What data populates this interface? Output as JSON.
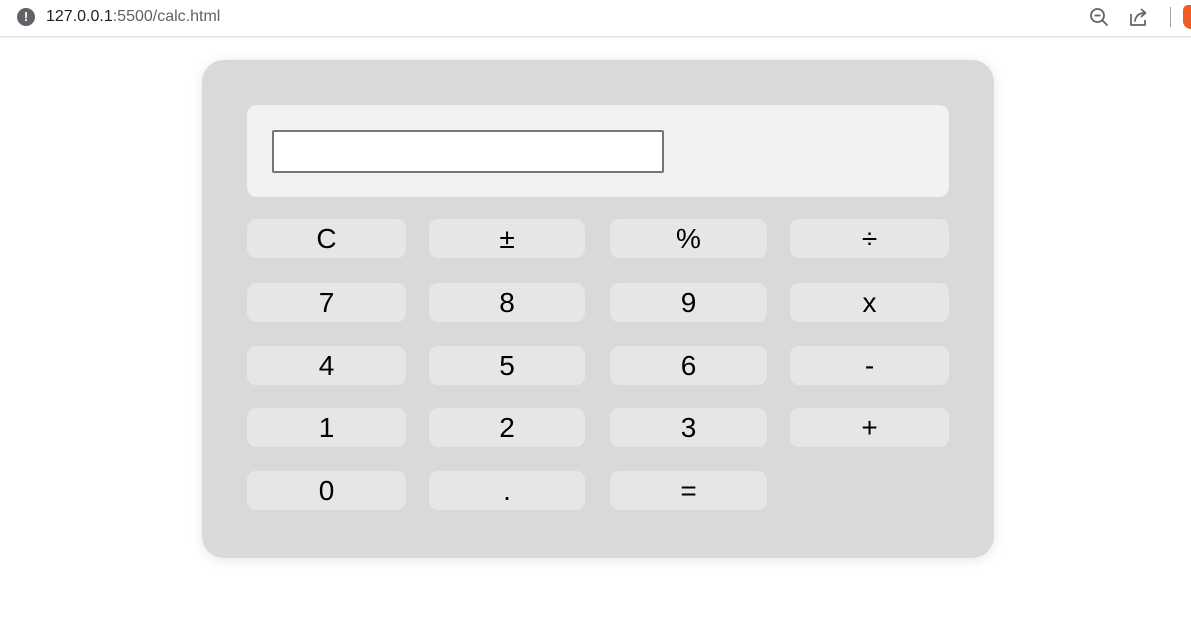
{
  "browser": {
    "url_host": "127.0.0.1",
    "url_path": ":5500/calc.html",
    "info_icon": "info-icon",
    "icons": [
      "zoom-out-icon",
      "share-icon",
      "brave-lion-icon"
    ]
  },
  "calculator": {
    "display": {
      "value": "",
      "placeholder": ""
    },
    "keys": {
      "clear": "C",
      "plus_minus": "±",
      "percent": "%",
      "divide": "÷",
      "seven": "7",
      "eight": "8",
      "nine": "9",
      "multiply": "x",
      "four": "4",
      "five": "5",
      "six": "6",
      "subtract": "-",
      "one": "1",
      "two": "2",
      "three": "3",
      "add": "+",
      "zero": "0",
      "decimal": ".",
      "equals": "="
    }
  },
  "colors": {
    "calculator_body": "#d9d9d9",
    "display_panel": "#f2f2f2",
    "key_background": "#e6e6e6",
    "brave_accent": "#f05a24"
  }
}
